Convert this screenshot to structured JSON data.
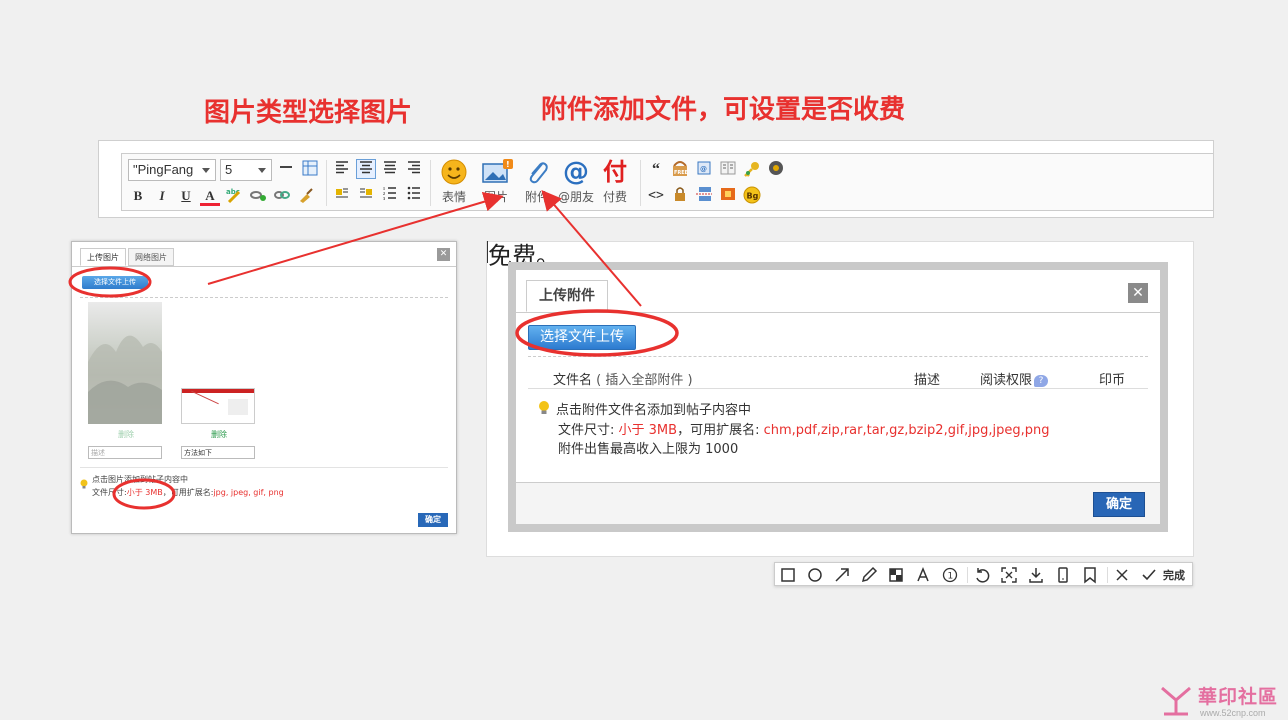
{
  "annotations": {
    "left": "图片类型选择图片",
    "right": "附件添加文件，可设置是否收费"
  },
  "editor": {
    "font_select": "\"PingFang",
    "size_select": "5",
    "bold": "B",
    "italic": "I",
    "underline": "U",
    "fontcolor": "A",
    "big_buttons": [
      {
        "label": "表情",
        "icon": "emoji-icon"
      },
      {
        "label": "图片",
        "icon": "image-icon"
      },
      {
        "label": "附件",
        "icon": "paperclip-icon"
      },
      {
        "label": "@朋友",
        "icon": "at-icon"
      },
      {
        "label": "付费",
        "icon": "pay-icon"
      }
    ],
    "pay_glyph": "付",
    "at_glyph": "@"
  },
  "left_dialog": {
    "tabs": [
      "上传图片",
      "网络图片"
    ],
    "upload_button": "选择文件上传",
    "delete_label": "删除",
    "input1_placeholder": "描述",
    "input2_value": "方法如下",
    "tip_line1": "点击图片添加到帖子内容中",
    "tip_line2_prefix": "文件尺寸:",
    "tip_line2_size": "小于 3MB",
    "tip_line2_mid": "，可用扩展名:",
    "tip_line2_ext": "jpg, jpeg, gif, png",
    "ok_button": "确定"
  },
  "right_dialog": {
    "body_text": "免费。",
    "tab": "上传附件",
    "upload_button": "选择文件上传",
    "columns": {
      "filename": "文件名",
      "insert_all": "( 插入全部附件 )",
      "desc": "描述",
      "permission": "阅读权限",
      "coins": "印币"
    },
    "help_mark": "?",
    "tip_line1": "点击附件文件名添加到帖子内容中",
    "tip_line2_prefix": "文件尺寸:",
    "tip_line2_size": "小于 3MB",
    "tip_line2_mid": "，可用扩展名:",
    "tip_line2_ext": "chm,pdf,zip,rar,tar,gz,bzip2,gif,jpg,jpeg,png",
    "tip_line3": "附件出售最高收入上限为 1000",
    "ok_button": "确定"
  },
  "snap_toolbar": {
    "done_label": "完成"
  },
  "watermark": {
    "text": "華印社區",
    "url": "www.52cnp.com"
  },
  "colors": {
    "annotation_red": "#e8312f",
    "button_blue": "#2866b6",
    "link_red": "#e8312f"
  }
}
